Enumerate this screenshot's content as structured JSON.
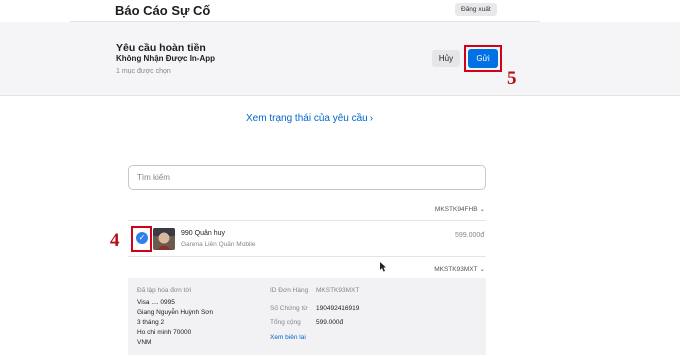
{
  "topbar": {
    "title": "Báo Cáo Sự Cố",
    "signout_label": "Đăng xuất"
  },
  "request": {
    "title": "Yêu cầu hoàn tiền",
    "subtitle": "Không Nhận Được In-App",
    "selected_count": "1 mục được chọn",
    "cancel_label": "Hủy",
    "send_label": "Gửi"
  },
  "annotations": {
    "step5": "5",
    "step4": "4"
  },
  "status_link": {
    "label": "Xem trạng thái của yêu cầu",
    "chevron": "›"
  },
  "search": {
    "placeholder": "Tìm kiếm"
  },
  "orders": [
    {
      "id_label": "MKSTK94FHB",
      "chevron": "⌄",
      "item": {
        "name": "990 Quân huy",
        "app": "Garena Liên Quân Mobile",
        "price": "599.000đ",
        "checked": true
      }
    },
    {
      "id_label": "MKSTK93MXT",
      "chevron": "⌄"
    }
  ],
  "details": {
    "billed_label": "Đã lập hóa đơn tới",
    "address_lines": [
      "Visa .... 0995",
      "Giang Nguyễn Huỳnh Sơn",
      "3 tháng 2",
      "Ho chi minh 70000",
      "VNM"
    ],
    "order_id_label": "ID Đơn Hàng",
    "order_id_value": "MKSTK93MXT",
    "doc_label": "Số Chứng từ",
    "doc_value": "190492416919",
    "total_label": "Tổng cộng",
    "total_value": "599.000đ",
    "receipt_link": "Xem biên lai"
  },
  "colors": {
    "accent": "#0071e3",
    "link": "#0066cc",
    "highlight": "#d0021b",
    "check": "#2f80ed"
  }
}
